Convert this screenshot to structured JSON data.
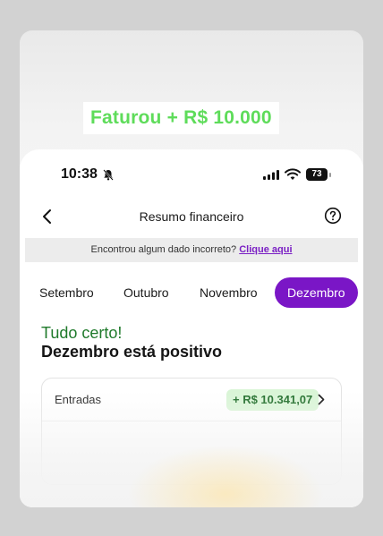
{
  "headline": "Faturou + R$ 10.000",
  "status_bar": {
    "time": "10:38",
    "battery": "73",
    "icons": [
      "bell-off-icon",
      "signal-icon",
      "wifi-icon",
      "battery-icon"
    ]
  },
  "nav": {
    "title": "Resumo financeiro",
    "back_icon": "chevron-left-icon",
    "help_icon": "help-circle-icon"
  },
  "banner": {
    "text": "Encontrou algum dado incorreto?",
    "link": "Clique aqui"
  },
  "tabs": [
    {
      "label": "Setembro",
      "active": false
    },
    {
      "label": "Outubro",
      "active": false
    },
    {
      "label": "Novembro",
      "active": false
    },
    {
      "label": "Dezembro",
      "active": true
    }
  ],
  "summary": {
    "title": "Tudo certo!",
    "subtitle": "Dezembro está positivo"
  },
  "entries": [
    {
      "label": "Entradas",
      "value": "+ R$ 10.341,07"
    }
  ],
  "colors": {
    "accent": "#7a16c6",
    "positive_text": "#1f7a2b",
    "positive_pill": "#d9f5d6",
    "headline": "#5edc5a"
  }
}
